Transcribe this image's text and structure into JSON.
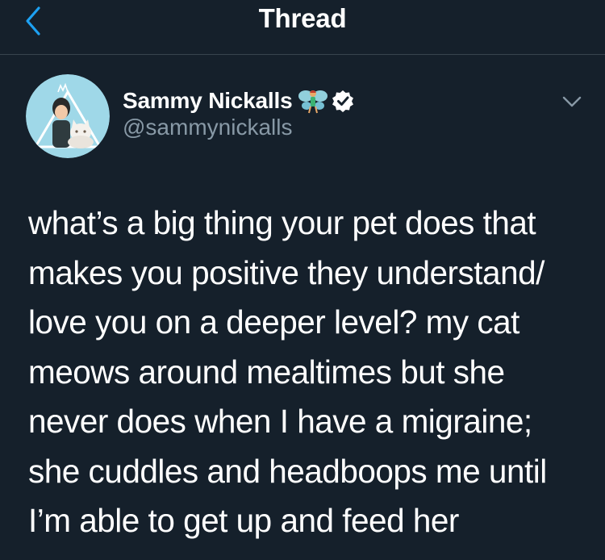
{
  "header": {
    "title": "Thread",
    "back_icon": "chevron-left-icon"
  },
  "tweet": {
    "author": {
      "name": "Sammy Nickalls",
      "handle": "@sammynickalls",
      "name_emoji": "fairy-icon",
      "verified_badge": "verified-icon"
    },
    "menu_icon": "chevron-down-icon",
    "text_lines": [
      "what’s a big thing your pet does that",
      "makes you positive they understand/",
      "love you on a deeper level? my cat",
      "meows around mealtimes but she",
      "never does when I have a migraine;",
      "she cuddles and headboops me until",
      "I’m able to get up and feed her"
    ]
  },
  "colors": {
    "background": "#15202b",
    "accent": "#1da1f2",
    "secondary_text": "#8899a6",
    "divider": "#38444d"
  }
}
